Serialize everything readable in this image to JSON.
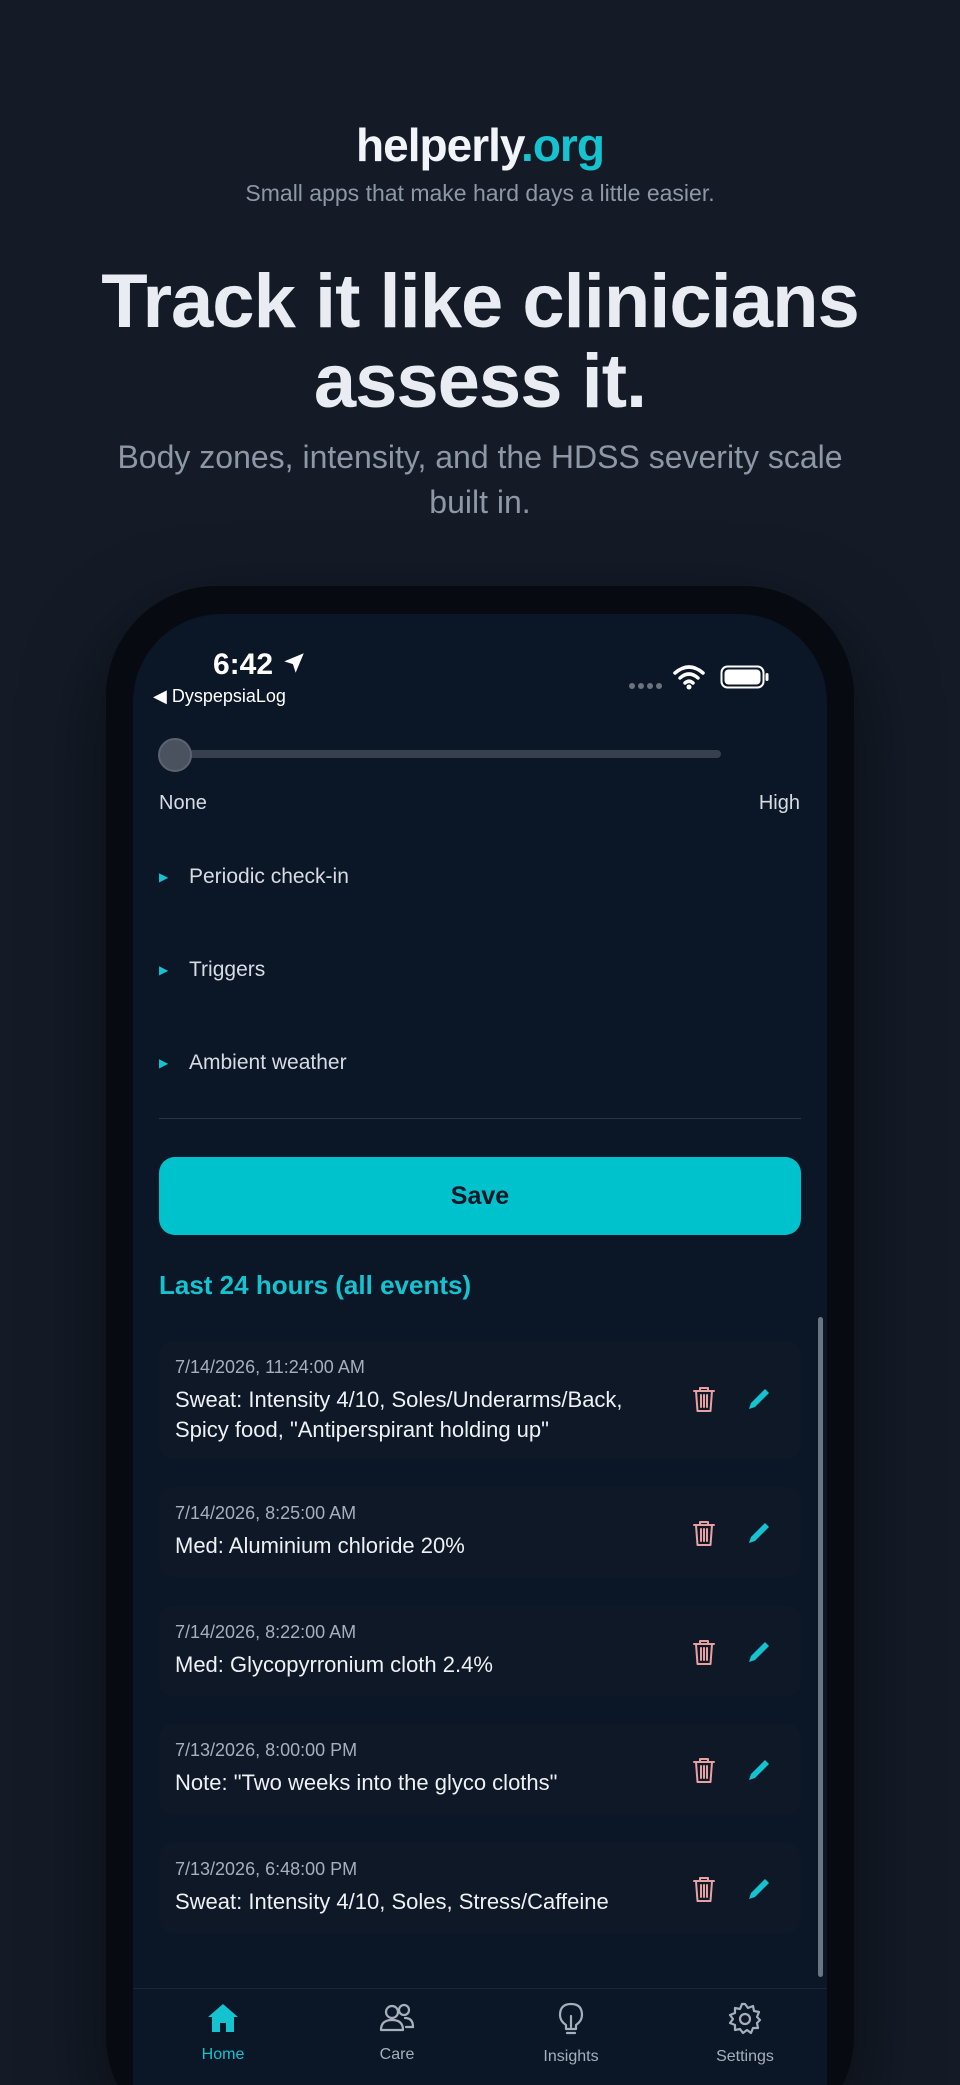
{
  "brand": {
    "name": "helperly",
    "tld": ".org",
    "tagline": "Small apps that make hard days a little easier."
  },
  "hero": {
    "headline_line1": "Track it like clinicians",
    "headline_line2": "assess it.",
    "subhead_line1": "Body zones, intensity, and the HDSS severity scale",
    "subhead_line2": "built in."
  },
  "status_bar": {
    "time": "6:42",
    "back_app": "◀ DyspepsiaLog"
  },
  "slider": {
    "min_label": "None",
    "max_label": "High",
    "value": 0
  },
  "sections": [
    {
      "label": "Periodic check-in"
    },
    {
      "label": "Triggers"
    },
    {
      "label": "Ambient weather"
    }
  ],
  "save_label": "Save",
  "events_title": "Last 24 hours (all events)",
  "events": [
    {
      "timestamp": "7/14/2026, 11:24:00 AM",
      "line1": "Sweat: Intensity 4/10, Soles/Underarms/Back,",
      "line2": "Spicy food, \"Antiperspirant holding up\""
    },
    {
      "timestamp": "7/14/2026, 8:25:00 AM",
      "line1": "Med: Aluminium chloride 20%",
      "line2": ""
    },
    {
      "timestamp": "7/14/2026, 8:22:00 AM",
      "line1": "Med: Glycopyrronium cloth 2.4%",
      "line2": ""
    },
    {
      "timestamp": "7/13/2026, 8:00:00 PM",
      "line1": "Note: \"Two weeks into the glyco cloths\"",
      "line2": ""
    },
    {
      "timestamp": "7/13/2026, 6:48:00 PM",
      "line1": "Sweat: Intensity 4/10, Soles, Stress/Caffeine",
      "line2": ""
    }
  ],
  "tabs": [
    {
      "label": "Home",
      "icon": "home-icon",
      "active": true
    },
    {
      "label": "Care",
      "icon": "people-icon",
      "active": false
    },
    {
      "label": "Insights",
      "icon": "lightbulb-icon",
      "active": false
    },
    {
      "label": "Settings",
      "icon": "gear-icon",
      "active": false
    }
  ],
  "colors": {
    "accent": "#14c3cf",
    "background": "#141b27",
    "screen": "#0b1627",
    "trash": "#e8a1a1"
  }
}
